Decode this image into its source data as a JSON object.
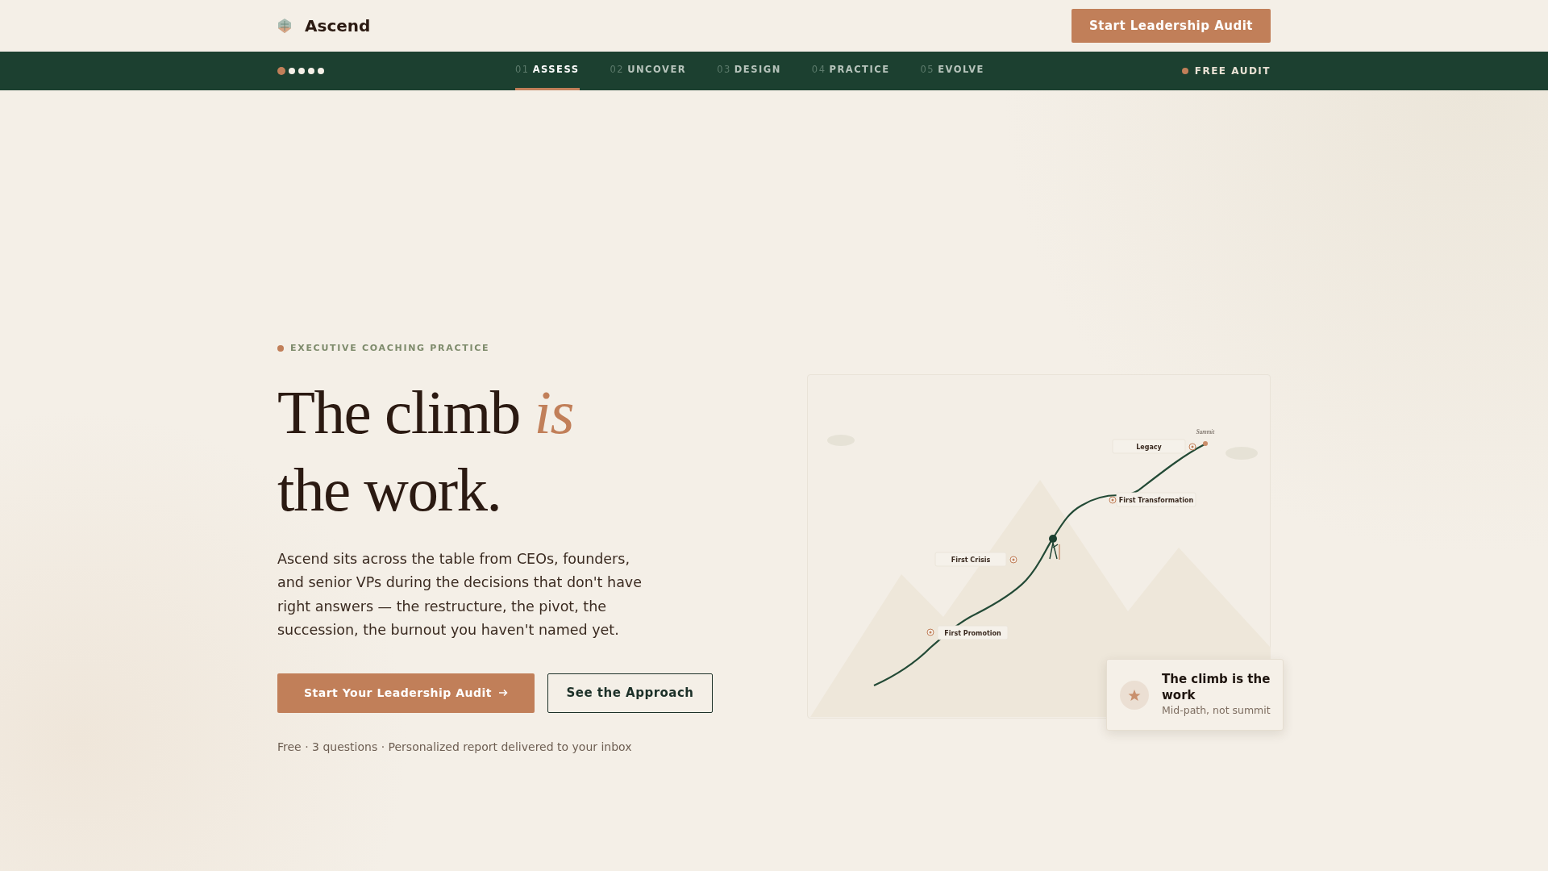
{
  "header": {
    "brand": "Ascend",
    "cta": "Start Leadership Audit"
  },
  "step_nav": {
    "dots": [
      {
        "selected": true
      },
      {
        "selected": false
      },
      {
        "selected": false
      },
      {
        "selected": false
      },
      {
        "selected": false
      }
    ],
    "steps": [
      {
        "number": "01",
        "label": "ASSESS",
        "selected": true
      },
      {
        "number": "02",
        "label": "UNCOVER",
        "selected": false
      },
      {
        "number": "03",
        "label": "DESIGN",
        "selected": false
      },
      {
        "number": "04",
        "label": "PRACTICE",
        "selected": false
      },
      {
        "number": "05",
        "label": "EVOLVE",
        "selected": false
      }
    ],
    "free_audit": "FREE AUDIT"
  },
  "hero": {
    "eyebrow": "EXECUTIVE COACHING PRACTICE",
    "heading_line_1": "The climb *is*",
    "heading_line_2": "the work.",
    "body": "Ascend sits across the table from CEOs, founders, and senior VPs during the decisions that don't have right answers — the restructure, the pivot, the succession, the burnout you haven't named yet.",
    "primary_button": "Start Your Leadership Audit",
    "secondary_button": "See the Approach",
    "footnote": "Free · 3 questions · Personalized report delivered to your inbox"
  },
  "illustration": {
    "summit": "Summit",
    "milestones": [
      {
        "label": "Legacy"
      },
      {
        "label": "First Transformation"
      },
      {
        "label": "First Crisis"
      },
      {
        "label": "First Promotion"
      }
    ],
    "caption_card": {
      "title": "The climb is the work",
      "subtitle": "Mid-path, not summit"
    }
  }
}
